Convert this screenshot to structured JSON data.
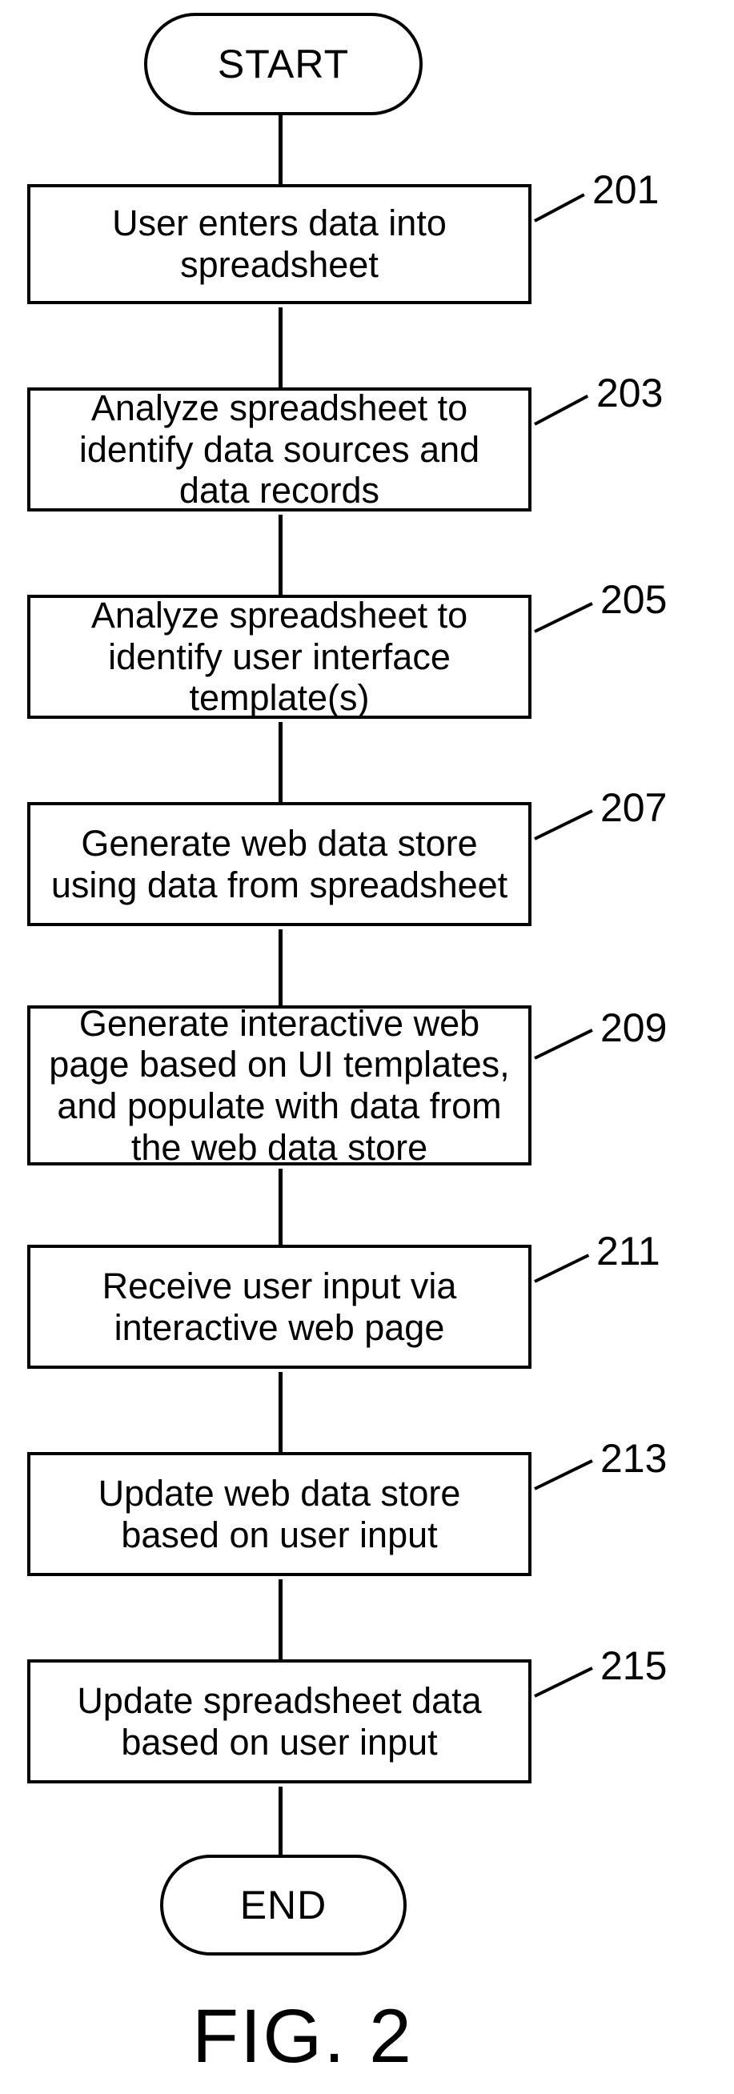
{
  "figure_label": "FIG. 2",
  "start_label": "START",
  "end_label": "END",
  "steps": [
    {
      "ref": "201",
      "text": "User enters data into spreadsheet"
    },
    {
      "ref": "203",
      "text": "Analyze spreadsheet to identify data sources and data records"
    },
    {
      "ref": "205",
      "text": "Analyze spreadsheet to identify user interface template(s)"
    },
    {
      "ref": "207",
      "text": "Generate web data store using data from spreadsheet"
    },
    {
      "ref": "209",
      "text": "Generate interactive web page based on UI templates, and populate with data from the web data store"
    },
    {
      "ref": "211",
      "text": "Receive user input via interactive web page"
    },
    {
      "ref": "213",
      "text": "Update web data store based on user input"
    },
    {
      "ref": "215",
      "text": "Update spreadsheet data based on user input"
    }
  ]
}
